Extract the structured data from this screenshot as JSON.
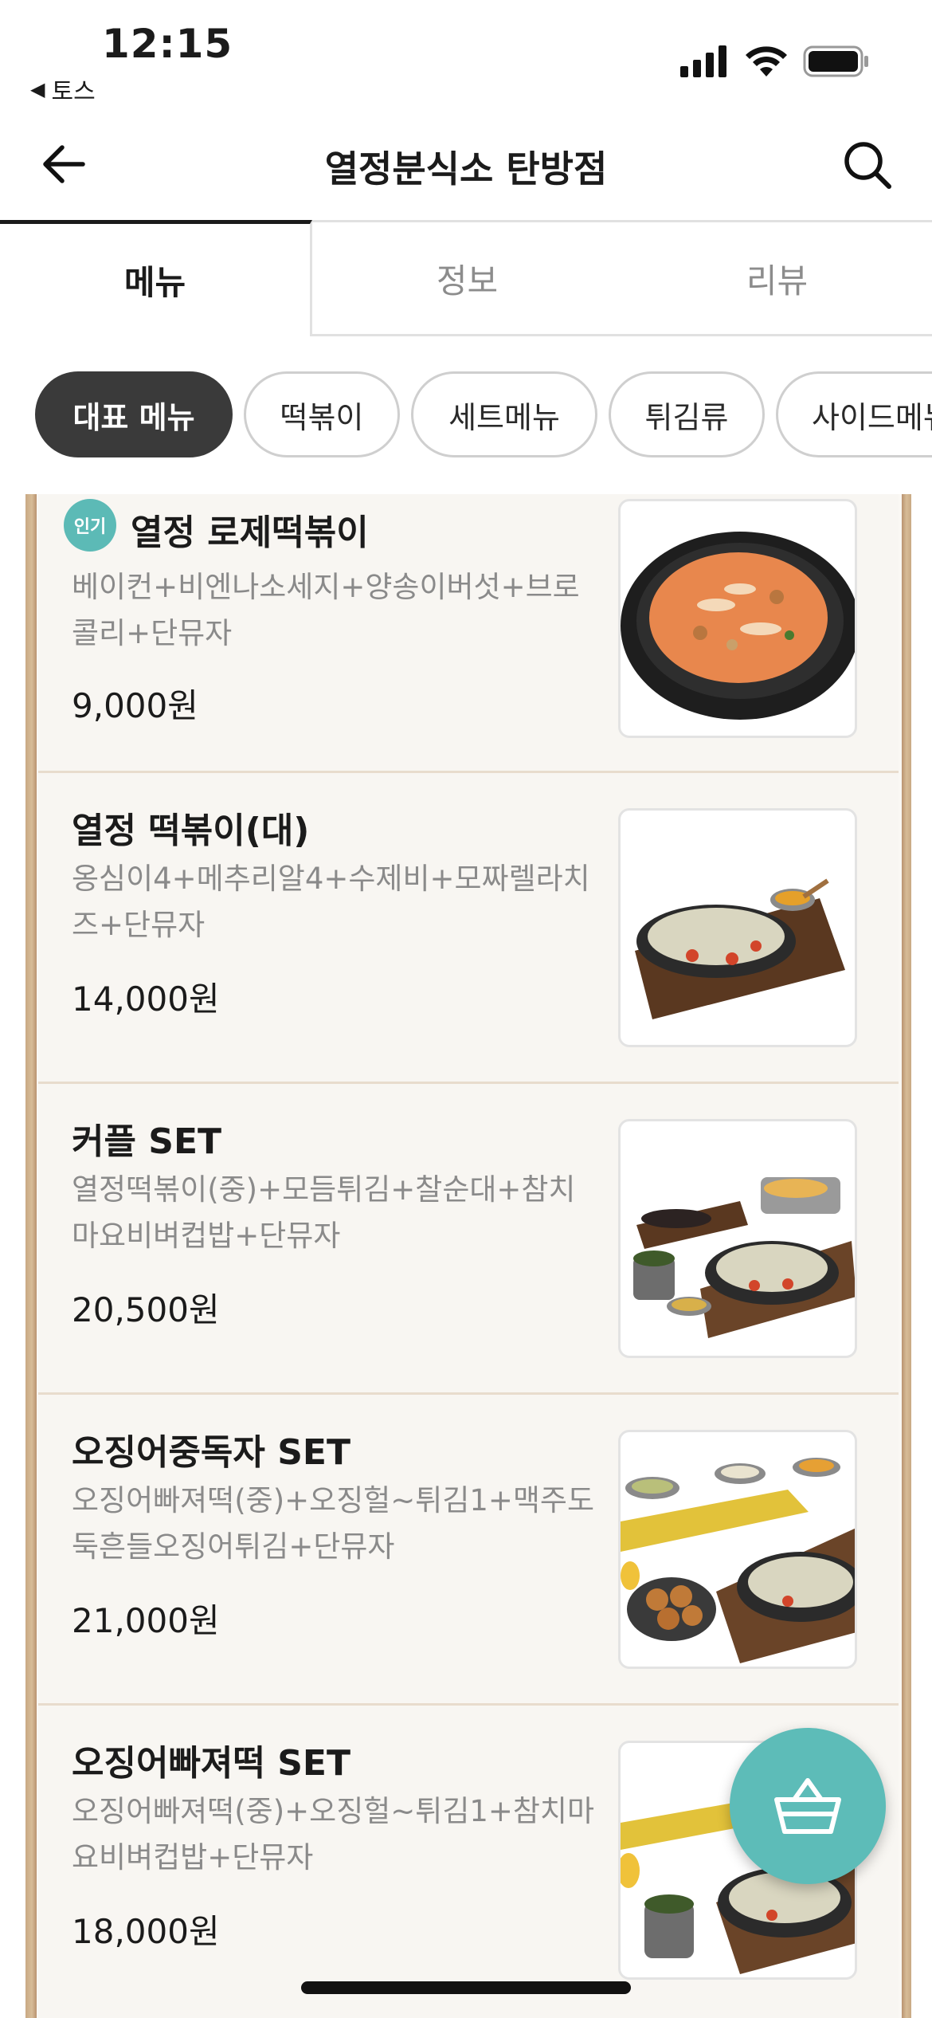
{
  "status_bar": {
    "time": "12:15",
    "back_app_label": "토스",
    "icons": [
      "cellular-signal-icon",
      "wifi-icon",
      "battery-icon"
    ]
  },
  "nav": {
    "title": "열정분식소 탄방점",
    "back_icon": "arrow-left-icon",
    "search_icon": "search-icon"
  },
  "tabs": [
    {
      "label": "메뉴",
      "active": true
    },
    {
      "label": "정보",
      "active": false
    },
    {
      "label": "리뷰",
      "active": false
    }
  ],
  "categories": [
    {
      "label": "대표 메뉴",
      "active": true
    },
    {
      "label": "떡볶이",
      "active": false
    },
    {
      "label": "세트메뉴",
      "active": false
    },
    {
      "label": "튀김류",
      "active": false
    },
    {
      "label": "사이드메뉴",
      "active": false
    }
  ],
  "menu_items": [
    {
      "badge": "인기",
      "name": "열정 로제떡볶이",
      "desc_lines": [
        "베이컨+비엔나소세지+양송이버섯+브로",
        "콜리+단뮤자"
      ],
      "price": "9,000원"
    },
    {
      "badge": "",
      "name": "열정 떡볶이(대)",
      "desc_lines": [
        "옹심이4+메추리알4+수제비+모짜렐라치",
        "즈+단뮤자"
      ],
      "price": "14,000원"
    },
    {
      "badge": "",
      "name": "커플 SET",
      "desc_lines": [
        "열정떡볶이(중)+모듬튀김+찰순대+참치",
        "마요비벼컵밥+단뮤자"
      ],
      "price": "20,500원"
    },
    {
      "badge": "",
      "name": "오징어중독자 SET",
      "desc_lines": [
        "오징어빠져떡(중)+오징헐~튀김1+맥주도",
        "둑흔들오징어튀김+단뮤자"
      ],
      "price": "21,000원"
    },
    {
      "badge": "",
      "name": "오징어빠져떡 SET",
      "desc_lines": [
        "오징어빠져떡(중)+오징헐~튀김1+참치마",
        "요비벼컵밥+단뮤자"
      ],
      "price": "18,000원"
    }
  ],
  "cart": {
    "icon": "shopping-basket-icon"
  },
  "colors": {
    "accent": "#5dbcb8",
    "chip_active": "#3a3a3a",
    "board_border": "#c9a984"
  }
}
